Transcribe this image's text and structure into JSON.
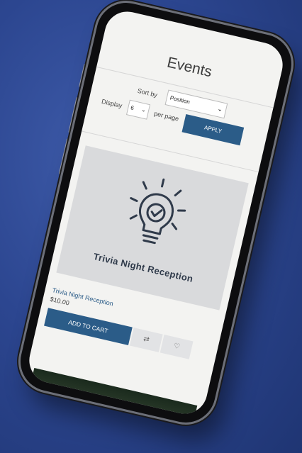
{
  "page": {
    "title": "Events"
  },
  "toolbar": {
    "sort_label": "Sort by",
    "sort_value": "Position",
    "display_label": "Display",
    "display_value": "6",
    "per_page_label": "per page",
    "apply_label": "APPLY"
  },
  "products": [
    {
      "image_text": "Trivia Night Reception",
      "name": "Trivia Night Reception",
      "price": "$10.00",
      "add_to_cart_label": "ADD TO CART",
      "compare_icon": "compare-icon",
      "wishlist_icon": "heart-icon"
    }
  ],
  "colors": {
    "accent": "#2b5c88",
    "background": "#2c4690",
    "image_placeholder": "#d9dadc"
  },
  "icons": {
    "product_image": "lightbulb-check-icon",
    "sort_dropdown": "chevron-down-icon",
    "display_dropdown": "chevron-down-icon"
  }
}
